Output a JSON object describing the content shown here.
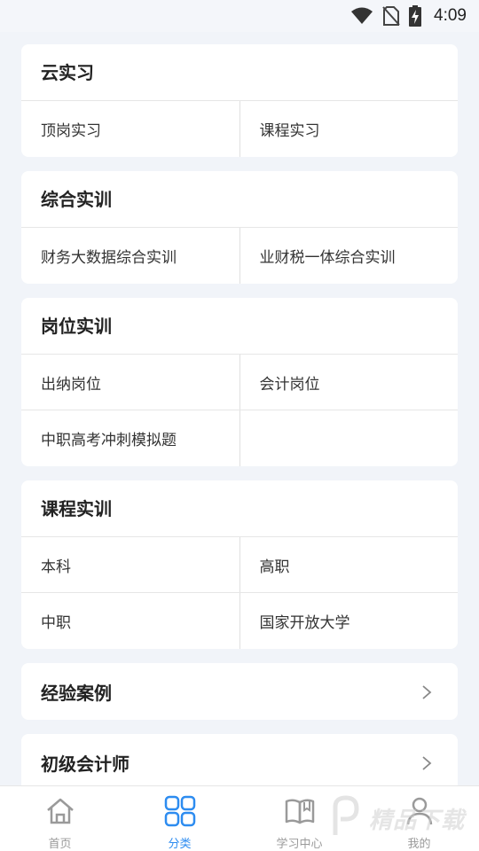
{
  "status_bar": {
    "time": "4:09"
  },
  "sections": [
    {
      "title": "云实习",
      "rows": [
        [
          "顶岗实习",
          "课程实习"
        ]
      ]
    },
    {
      "title": "综合实训",
      "rows": [
        [
          "财务大数据综合实训",
          "业财税一体综合实训"
        ]
      ]
    },
    {
      "title": "岗位实训",
      "rows": [
        [
          "出纳岗位",
          "会计岗位"
        ],
        [
          "中职高考冲刺模拟题",
          ""
        ]
      ]
    },
    {
      "title": "课程实训",
      "rows": [
        [
          "本科",
          "高职"
        ],
        [
          "中职",
          "国家开放大学"
        ]
      ]
    }
  ],
  "links": [
    {
      "title": "经验案例"
    },
    {
      "title": "初级会计师"
    }
  ],
  "bottom_nav": [
    {
      "label": "首页",
      "icon": "home-icon",
      "active": false
    },
    {
      "label": "分类",
      "icon": "grid-icon",
      "active": true
    },
    {
      "label": "学习中心",
      "icon": "book-icon",
      "active": false
    },
    {
      "label": "我的",
      "icon": "user-icon",
      "active": false
    }
  ],
  "colors": {
    "accent": "#2d8cf0",
    "inactive": "#9a9a9a",
    "background": "#f1f4f9"
  },
  "watermark": {
    "text": "精品下载"
  }
}
